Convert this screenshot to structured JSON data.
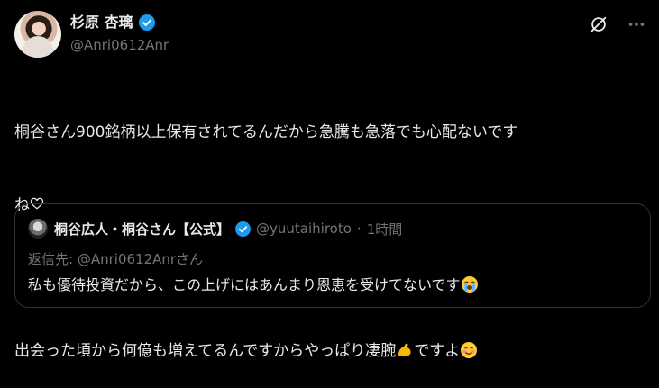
{
  "header": {
    "display_name": "杉原 杏璃",
    "handle": "@Anri0612Anr"
  },
  "tweet": {
    "line1": "桐谷さん900銘柄以上保有されてるんだから急騰も急落でも心配ないです",
    "line2_text": "ね",
    "line3_text": "出会った頃から何億も増えてるんですからやっぱり凄腕",
    "line3_tail": "ですよ"
  },
  "quote": {
    "display_name": "桐谷広人・桐谷さん【公式】",
    "handle": "@yuutaihiroto",
    "separator": "·",
    "time": "1時間",
    "reply_prefix": "返信先:",
    "reply_handle": "@Anri0612Anrさん",
    "text": "私も優待投資だから、この上げにはあんまり恩恵を受けてないです"
  },
  "icons": {
    "verified": "verified-badge-icon",
    "grok": "grok-icon",
    "more": "more-options-icon",
    "heart": "white-heart-icon",
    "muscle": "flexed-biceps-emoji",
    "smile": "smiling-face-emoji",
    "cry": "loudly-crying-face-emoji"
  },
  "colors": {
    "background": "#000000",
    "text": "#e7e9ea",
    "muted": "#71767b",
    "verified": "#1d9bf0",
    "border": "#2f3336"
  }
}
